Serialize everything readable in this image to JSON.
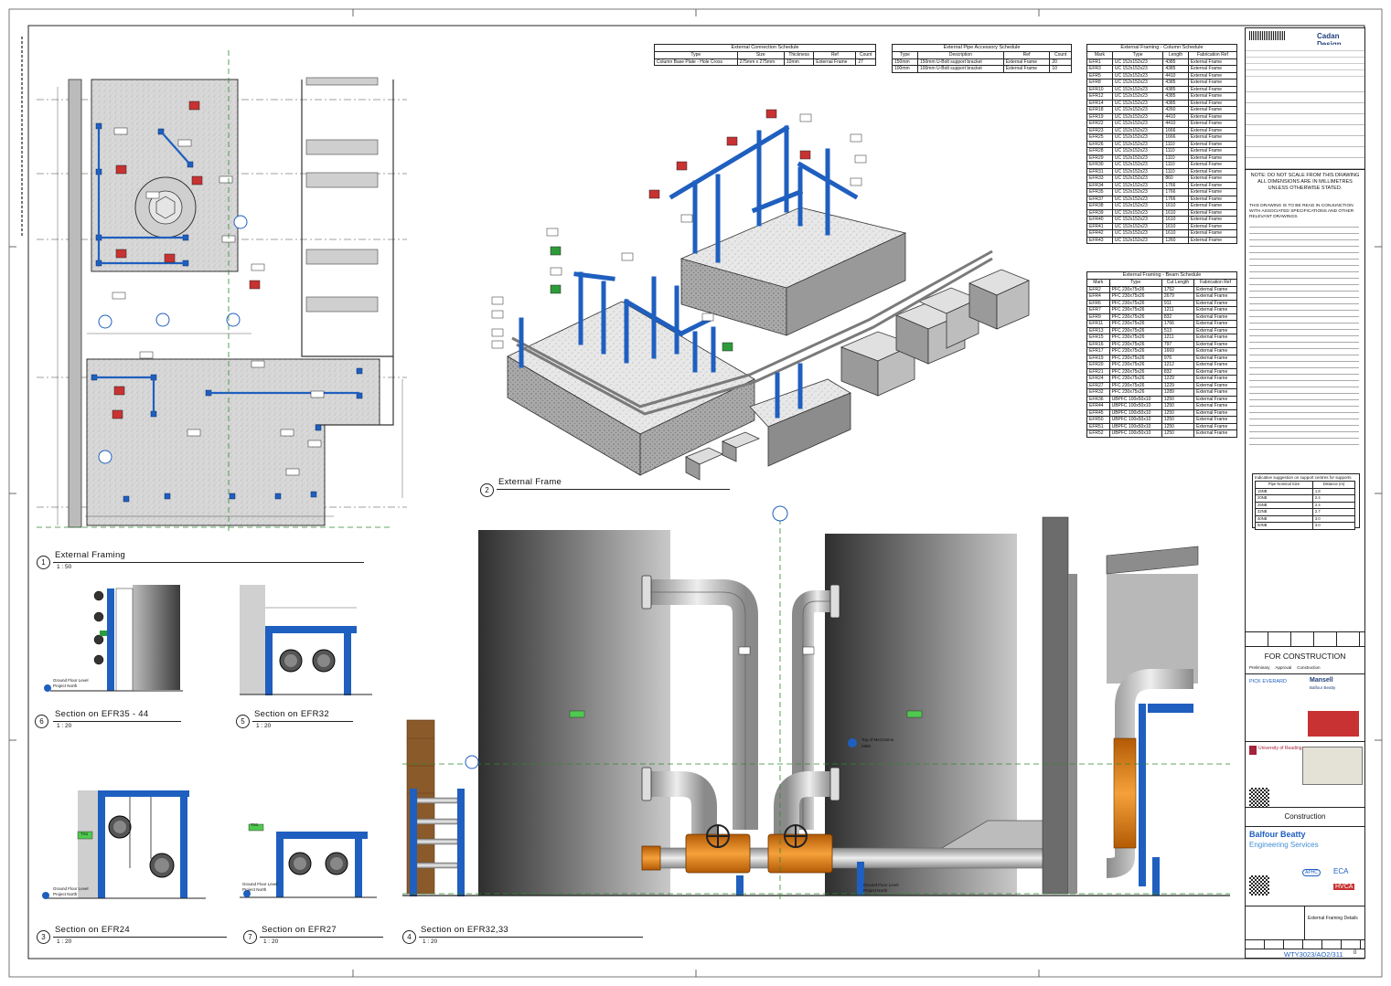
{
  "schedules": {
    "connection": {
      "title": "External Connection Schedule",
      "headers": [
        "Type",
        "Size",
        "Thickness",
        "Ref",
        "Count"
      ],
      "rows": [
        [
          "Column Base Plate - Hole Cross",
          "275mm x 275mm",
          "10mm",
          "External Frame",
          "27"
        ]
      ]
    },
    "pipe_access": {
      "title": "External Pipe Accessory Schedule",
      "headers": [
        "Type",
        "Description",
        "Ref",
        "Count"
      ],
      "rows": [
        [
          "150mm",
          "150mm U-Bolt support bracket",
          "External Frame",
          "20"
        ],
        [
          "100mm",
          "100mm U-Bolt support bracket",
          "External Frame",
          "10"
        ]
      ]
    },
    "column": {
      "title": "External Framing - Column Schedule",
      "headers": [
        "Mark",
        "Type",
        "Length",
        "Fabrication Ref"
      ],
      "rows": [
        [
          "EFR1",
          "UC 152x152x23",
          "4385",
          "External Frame"
        ],
        [
          "EFR3",
          "UC 152x152x23",
          "4385",
          "External Frame"
        ],
        [
          "EFR5",
          "UC 152x152x23",
          "4410",
          "External Frame"
        ],
        [
          "EFR8",
          "UC 152x152x23",
          "4385",
          "External Frame"
        ],
        [
          "EFR10",
          "UC 152x152x23",
          "4385",
          "External Frame"
        ],
        [
          "EFR12",
          "UC 152x152x23",
          "4385",
          "External Frame"
        ],
        [
          "EFR14",
          "UC 152x152x23",
          "4385",
          "External Frame"
        ],
        [
          "EFR18",
          "UC 152x152x23",
          "4260",
          "External Frame"
        ],
        [
          "EFR19",
          "UC 152x152x23",
          "4410",
          "External Frame"
        ],
        [
          "EFR22",
          "UC 152x152x23",
          "4410",
          "External Frame"
        ],
        [
          "EFR23",
          "UC 152x152x23",
          "1666",
          "External Frame"
        ],
        [
          "EFR25",
          "UC 152x152x23",
          "1666",
          "External Frame"
        ],
        [
          "EFR26",
          "UC 152x152x23",
          "1110",
          "External Frame"
        ],
        [
          "EFR28",
          "UC 152x152x23",
          "1110",
          "External Frame"
        ],
        [
          "EFR29",
          "UC 152x152x23",
          "1110",
          "External Frame"
        ],
        [
          "EFR30",
          "UC 152x152x23",
          "1110",
          "External Frame"
        ],
        [
          "EFR31",
          "UC 152x152x23",
          "1110",
          "External Frame"
        ],
        [
          "EFR33",
          "UC 152x152x23",
          "860",
          "External Frame"
        ],
        [
          "EFR34",
          "UC 152x152x23",
          "1766",
          "External Frame"
        ],
        [
          "EFR35",
          "UC 152x152x23",
          "1766",
          "External Frame"
        ],
        [
          "EFR37",
          "UC 152x152x23",
          "1766",
          "External Frame"
        ],
        [
          "EFR38",
          "UC 152x152x23",
          "1610",
          "External Frame"
        ],
        [
          "EFR39",
          "UC 152x152x23",
          "1610",
          "External Frame"
        ],
        [
          "EFR40",
          "UC 152x152x23",
          "1610",
          "External Frame"
        ],
        [
          "EFR41",
          "UC 152x152x23",
          "1610",
          "External Frame"
        ],
        [
          "EFR42",
          "UC 152x152x23",
          "1610",
          "External Frame"
        ],
        [
          "EFR43",
          "UC 152x152x23",
          "1260",
          "External Frame"
        ]
      ]
    },
    "beam": {
      "title": "External Framing - Beam Schedule",
      "headers": [
        "Mark",
        "Type",
        "Cut Length",
        "Fabrication Ref"
      ],
      "rows": [
        [
          "EFR2",
          "PFC 230x75x26",
          "1752",
          "External Frame"
        ],
        [
          "EFR4",
          "PFC 230x75x26",
          "2679",
          "External Frame"
        ],
        [
          "EFR6",
          "PFC 230x75x26",
          "911",
          "External Frame"
        ],
        [
          "EFR7",
          "PFC 230x75x26",
          "1211",
          "External Frame"
        ],
        [
          "EFR9",
          "PFC 230x75x26",
          "832",
          "External Frame"
        ],
        [
          "EFR11",
          "PFC 230x75x26",
          "1766",
          "External Frame"
        ],
        [
          "EFR13",
          "PFC 230x75x26",
          "513",
          "External Frame"
        ],
        [
          "EFR15",
          "PFC 230x75x26",
          "1211",
          "External Frame"
        ],
        [
          "EFR16",
          "PFC 230x75x26",
          "797",
          "External Frame"
        ],
        [
          "EFR17",
          "PFC 230x75x26",
          "1669",
          "External Frame"
        ],
        [
          "EFR19",
          "PFC 230x75x26",
          "976",
          "External Frame"
        ],
        [
          "EFR20",
          "PFC 230x75x26",
          "1212",
          "External Frame"
        ],
        [
          "EFR21",
          "PFC 230x75x26",
          "832",
          "External Frame"
        ],
        [
          "EFR24",
          "PFC 230x75x26",
          "1229",
          "External Frame"
        ],
        [
          "EFR27",
          "PFC 230x75x26",
          "1229",
          "External Frame"
        ],
        [
          "EFR32",
          "PFC 230x75x26",
          "1289",
          "External Frame"
        ],
        [
          "EFR36",
          "UBPFC 100x50x10",
          "1250",
          "External Frame"
        ],
        [
          "EFR44",
          "UBPFC 100x50x10",
          "1250",
          "External Frame"
        ],
        [
          "EFR45",
          "UBPFC 100x50x10",
          "1250",
          "External Frame"
        ],
        [
          "EFR50",
          "UBPFC 100x50x10",
          "1250",
          "External Frame"
        ],
        [
          "EFR51",
          "UBPFC 100x50x10",
          "1250",
          "External Frame"
        ],
        [
          "EFR52",
          "UBPFC 100x50x10",
          "1250",
          "External Frame"
        ]
      ]
    }
  },
  "views": {
    "v1": {
      "num": "1",
      "title": "External Framing",
      "scale": "1 : 50"
    },
    "v2": {
      "num": "2",
      "title": "External Frame"
    },
    "v3": {
      "num": "3",
      "title": "Section on EFR24",
      "scale": "1 : 20"
    },
    "v4": {
      "num": "4",
      "title": "Section on EFR32,33",
      "scale": "1 : 20"
    },
    "v5": {
      "num": "5",
      "title": "Section on EFR32",
      "scale": "1 : 20"
    },
    "v6": {
      "num": "6",
      "title": "Section on EFR35 - 44",
      "scale": "1 : 20"
    },
    "v7": {
      "num": "7",
      "title": "Section on EFR27",
      "scale": "1 : 20"
    }
  },
  "annotations": {
    "ground_floor": "Ground Floor Level",
    "project_north": "Project North",
    "top_mezzanine": "Top of Mezzanine",
    "top_mezz_level": "2666",
    "ts1": "TS1"
  },
  "title_block": {
    "logo": "Cadan Design",
    "notes_header": "NOTE: DO NOT SCALE FROM THIS DRAWING ALL DIMENSIONS ARE IN MILLIMETRES UNLESS OTHERWISE STATED.",
    "notes_body": "THIS DRAWING IS TO BE READ IN CONJUNCTION WITH ASSOCIATED SPECIFICATIONS AND OTHER RELEVANT DRAWINGS.",
    "legend_title": "Indicative suggestion on support centres for supports",
    "legend_headers": [
      "Pipe Nominal Size",
      "Distance (m)"
    ],
    "legend_rows": [
      [
        "15NB",
        "1.8"
      ],
      [
        "20NB",
        "2.4"
      ],
      [
        "25NB",
        "2.4"
      ],
      [
        "32NB",
        "2.7"
      ],
      [
        "40NB",
        "3.0"
      ],
      [
        "50NB",
        "3.0"
      ]
    ],
    "status": "FOR CONSTRUCTION",
    "status_opts": [
      "Preliminary",
      "Approval",
      "Construction"
    ],
    "client1": "PICK EVERARD",
    "client2": "Mansell",
    "client2_sub": "Balfour Beatty",
    "university": "University of Reading",
    "stage": "Construction",
    "contractor1": "Balfour Beatty",
    "contractor2": "Engineering Services",
    "badges": [
      "APHC",
      "ECA",
      "HVCA"
    ],
    "drawing_title": "External Framing Details",
    "drawing_number": "WTY3023/AO2/311",
    "revision": "0"
  }
}
